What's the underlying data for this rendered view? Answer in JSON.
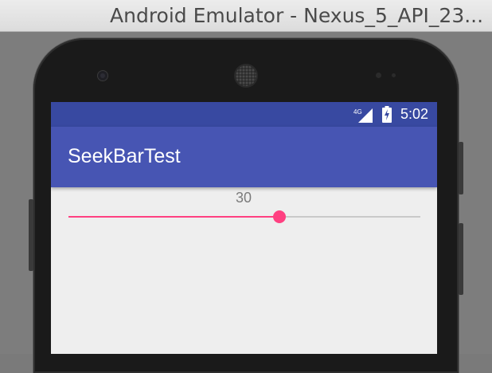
{
  "window": {
    "title": "Android Emulator - Nexus_5_API_23..."
  },
  "status_bar": {
    "time": "5:02",
    "network": "4G",
    "icons": [
      "signal-icon",
      "battery-icon"
    ]
  },
  "app": {
    "title": "SeekBarTest"
  },
  "seekbar": {
    "value_label": "30",
    "progress": 0.6,
    "accent_color": "#ff4081"
  },
  "colors": {
    "status_bar": "#3849a1",
    "app_bar": "#4755b3",
    "background": "#eeeeee"
  }
}
